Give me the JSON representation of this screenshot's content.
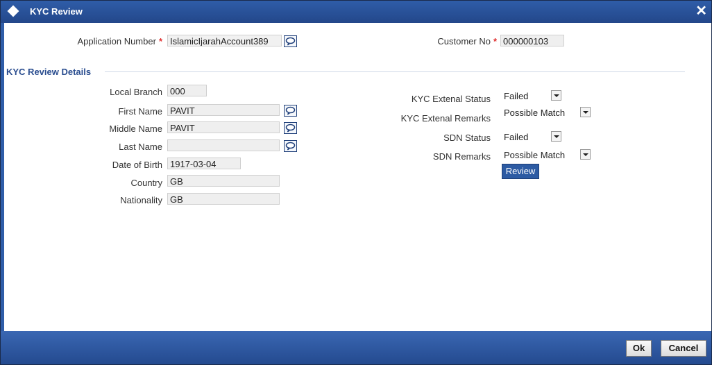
{
  "window": {
    "title": "KYC Review",
    "close_glyph": "✕"
  },
  "header": {
    "application_number_label": "Application Number",
    "application_number_value": "IslamicIjarahAccount389",
    "customer_no_label": "Customer No",
    "customer_no_value": "000000103",
    "required_marker": "*"
  },
  "section": {
    "title": "KYC Review Details"
  },
  "left_fields": {
    "local_branch": {
      "label": "Local Branch",
      "value": "000"
    },
    "first_name": {
      "label": "First Name",
      "value": "PAVIT"
    },
    "middle_name": {
      "label": "Middle Name",
      "value": "PAVIT"
    },
    "last_name": {
      "label": "Last Name",
      "value": ""
    },
    "date_of_birth": {
      "label": "Date of Birth",
      "value": "1917-03-04"
    },
    "country": {
      "label": "Country",
      "value": "GB"
    },
    "nationality": {
      "label": "Nationality",
      "value": "GB"
    }
  },
  "right_fields": {
    "kyc_external_status": {
      "label": "KYC Extenal Status",
      "value": "Failed"
    },
    "kyc_external_remarks": {
      "label": "KYC Extenal Remarks",
      "value": "Possible Match"
    },
    "sdn_status": {
      "label": "SDN Status",
      "value": "Failed"
    },
    "sdn_remarks": {
      "label": "SDN Remarks",
      "value": "Possible Match"
    }
  },
  "review_button": "Review",
  "footer": {
    "ok_label": "Ok",
    "cancel_label": "Cancel"
  },
  "icons": {
    "lov": "speech-bubble-icon",
    "dropdown": "chevron-down-icon"
  },
  "colors": {
    "title_bar": "#2f5da8",
    "section_title": "#2a4d8f",
    "required": "#e03030",
    "button_blue": "#2d5ba3"
  }
}
